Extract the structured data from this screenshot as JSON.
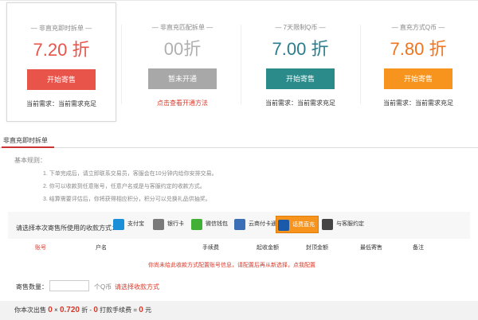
{
  "cards": [
    {
      "title": "— 非直充即时拆单 —",
      "discount": "7.20 折",
      "button": "开始寄售",
      "need": "当前需求：当前需求充足",
      "color": "#e8534a",
      "disc_color": "#e8534a"
    },
    {
      "title": "— 非直充匹配拆单 —",
      "discount": "00折",
      "button": "暂未开通",
      "link": "点击查看开通方法",
      "color": "#a8a8a8",
      "disc_color": "#b0b0b0"
    },
    {
      "title": "— 7天限制Q币 —",
      "discount": "7.00 折",
      "button": "开始寄售",
      "need": "当前需求：当前需求充足",
      "color": "#2b8a8a",
      "disc_color": "#2b7c8c"
    },
    {
      "title": "— 直充方式Q币 —",
      "discount": "7.80 折",
      "button": "开始寄售",
      "need": "当前需求：当前需求充足",
      "color": "#f7941d",
      "disc_color": "#f0731e"
    }
  ],
  "tab": "非直充即时拆单",
  "rules": {
    "title": "基本规则：",
    "items": [
      "1. 下单完成后，请立即联系交易员，客服会在10分钟内给你安排交易。",
      "2. 你可以收款到任意账号，任意户名或是与客服约定的收款方式。",
      "3. 结算需要评估后，你将获得相应积分，积分可以兑换礼品供抽奖。"
    ]
  },
  "payment": {
    "label": "请选择本次寄售所使用的收款方式：",
    "methods": [
      {
        "label": "支付宝",
        "icon": "alipay-icon",
        "color": "#1b8fd8"
      },
      {
        "label": "银行卡",
        "icon": "bank-card-icon",
        "color": "#7a7a7a"
      },
      {
        "label": "微信钱包",
        "icon": "wechat-icon",
        "color": "#41b035"
      },
      {
        "label": "云商付卡通",
        "icon": "cloud-pay-icon",
        "color": "#3b6fb6"
      },
      {
        "label": "话费直充",
        "icon": "phone-icon",
        "color": "#1a5aa8"
      },
      {
        "label": "与客服约定",
        "icon": "chat-icon",
        "color": "#444444"
      }
    ]
  },
  "table": {
    "headers": [
      "账号",
      "户名",
      "手续费",
      "起收金额",
      "封顶金额",
      "最低寄售",
      "备注"
    ]
  },
  "notice": "你尚未给此收款方式配置账号信息，请配置后再从新选择，点我配置",
  "quantity": {
    "label": "寄售数量：",
    "unit": "个Q币",
    "hint": "请选择收款方式"
  },
  "summary": {
    "prefix": "你本次出售",
    "qty": "0",
    "times": "×",
    "rate": "0.720",
    "zhe": "折 -",
    "fee": "0",
    "fee_label": "打款手续费 =",
    "total": "0",
    "yuan": "元"
  }
}
